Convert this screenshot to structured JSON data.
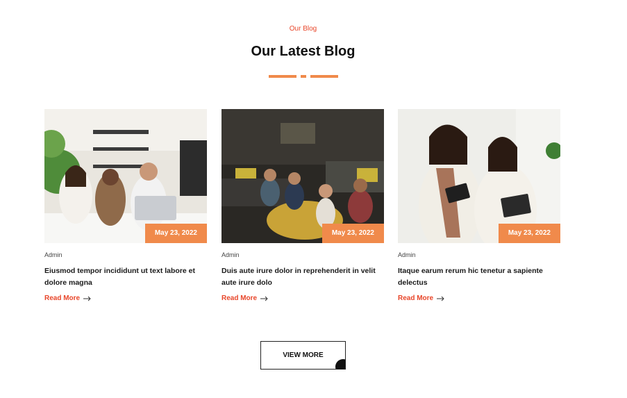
{
  "section": {
    "eyebrow": "Our Blog",
    "title": "Our Latest Blog"
  },
  "colors": {
    "accent": "#f08a4b",
    "accent_text": "#e8462a"
  },
  "posts": [
    {
      "date": "May 23, 2022",
      "author": "Admin",
      "title": "Eiusmod tempor incididunt ut text labore et dolore magna",
      "read_more": "Read More",
      "arrow_icon": "arrow-right-icon"
    },
    {
      "date": "May 23, 2022",
      "author": "Admin",
      "title": "Duis aute irure dolor in reprehenderit in velit aute irure dolo",
      "read_more": "Read More",
      "arrow_icon": "arrow-right-icon"
    },
    {
      "date": "May 23, 2022",
      "author": "Admin",
      "title": "Itaque earum rerum hic tenetur a sapiente delectus",
      "read_more": "Read More",
      "arrow_icon": "arrow-right-icon"
    }
  ],
  "view_more": {
    "label": "VIEW MORE"
  }
}
